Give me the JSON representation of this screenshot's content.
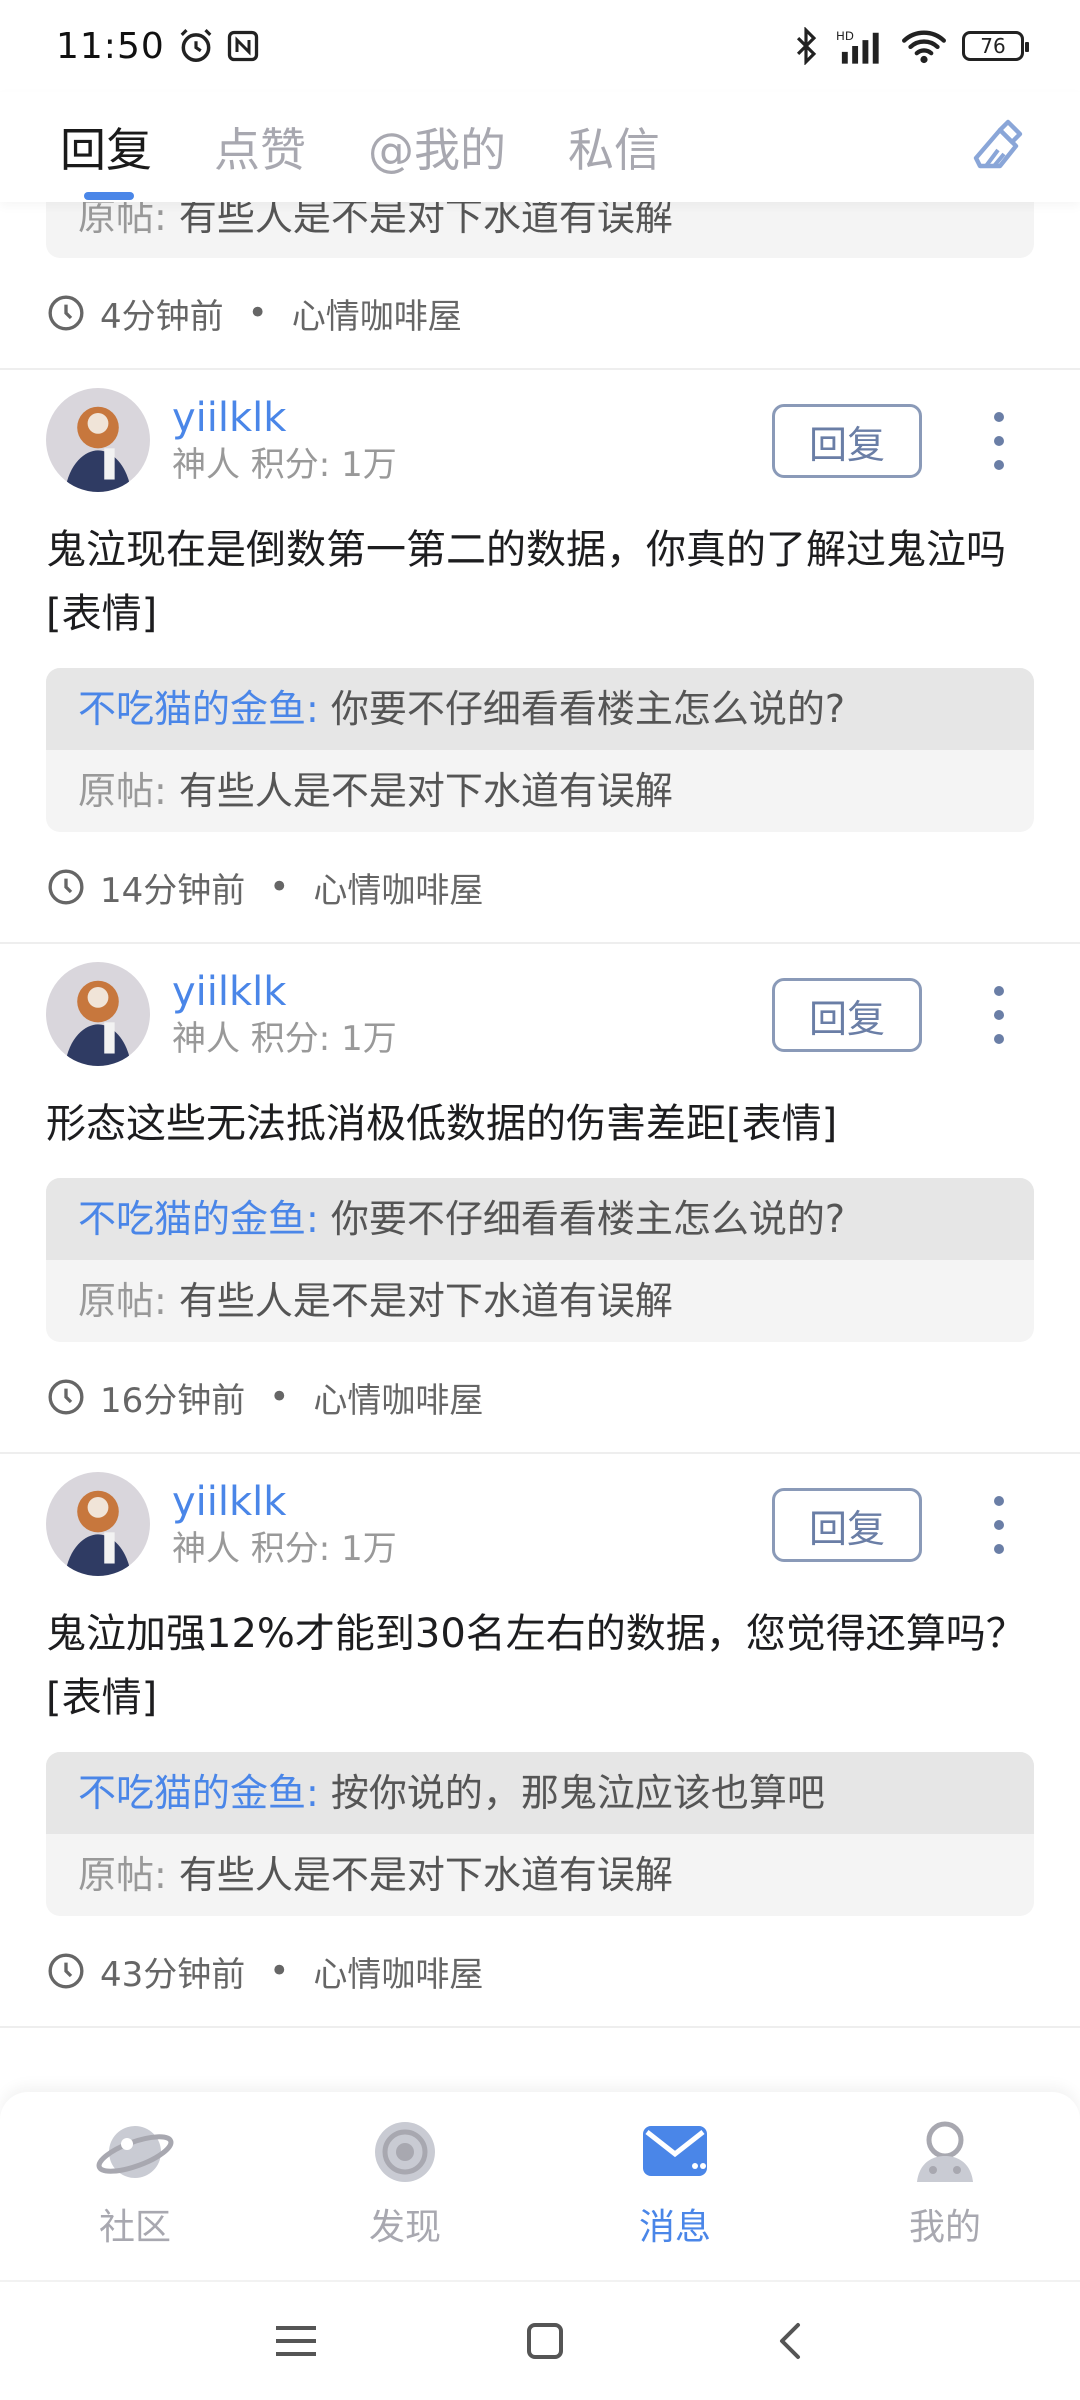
{
  "status_bar": {
    "time": "11:50",
    "battery": "76"
  },
  "tabs": [
    {
      "label": "回复",
      "active": true
    },
    {
      "label": "点赞",
      "active": false
    },
    {
      "label": "@我的",
      "active": false
    },
    {
      "label": "私信",
      "active": false
    }
  ],
  "items": [
    {
      "partial": true,
      "quote_origin_label": "原帖:",
      "quote_origin": "有些人是不是对下水道有误解",
      "time": "4分钟前",
      "forum": "心情咖啡屋"
    },
    {
      "user_name": "yiilklk",
      "user_meta": "神人  积分: 1万",
      "reply_label": "回复",
      "content": "鬼泣现在是倒数第一第二的数据，你真的了解过鬼泣吗[表情]",
      "quote_user": "不吃猫的金鱼:",
      "quote_text": "你要不仔细看看楼主怎么说的?",
      "quote_origin_label": "原帖:",
      "quote_origin": "有些人是不是对下水道有误解",
      "time": "14分钟前",
      "forum": "心情咖啡屋"
    },
    {
      "user_name": "yiilklk",
      "user_meta": "神人  积分: 1万",
      "reply_label": "回复",
      "content": "形态这些无法抵消极低数据的伤害差距[表情]",
      "quote_user": "不吃猫的金鱼:",
      "quote_text": "你要不仔细看看楼主怎么说的?",
      "quote_origin_label": "原帖:",
      "quote_origin": "有些人是不是对下水道有误解",
      "time": "16分钟前",
      "forum": "心情咖啡屋"
    },
    {
      "user_name": "yiilklk",
      "user_meta": "神人  积分: 1万",
      "reply_label": "回复",
      "content": "鬼泣加强12%才能到30名左右的数据，您觉得还算吗？[表情]",
      "quote_user": "不吃猫的金鱼:",
      "quote_text": "按你说的，那鬼泣应该也算吧",
      "quote_origin_label": "原帖:",
      "quote_origin": "有些人是不是对下水道有误解",
      "time": "43分钟前",
      "forum": "心情咖啡屋"
    }
  ],
  "bottom_nav": [
    {
      "label": "社区",
      "icon": "planet-icon",
      "active": false
    },
    {
      "label": "发现",
      "icon": "discover-icon",
      "active": false
    },
    {
      "label": "消息",
      "icon": "mail-icon",
      "active": true
    },
    {
      "label": "我的",
      "icon": "profile-icon",
      "active": false
    }
  ],
  "colors": {
    "accent": "#4a86e8",
    "inactive": "#a8a8b0",
    "quote_bg": "#f4f4f4",
    "quote_reply_bg": "#e6e6e6"
  }
}
